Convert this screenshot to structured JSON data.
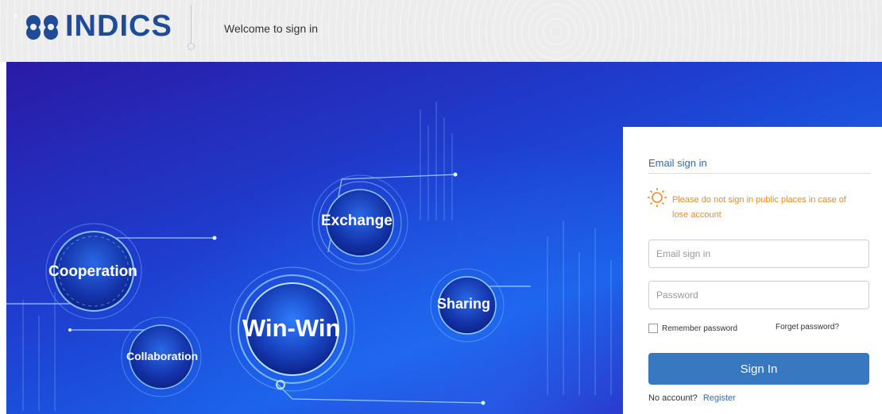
{
  "header": {
    "logo_text": "INDICS",
    "welcome": "Welcome to sign in"
  },
  "banner": {
    "circles": {
      "cooperation": "Cooperation",
      "exchange": "Exchange",
      "sharing": "Sharing",
      "winwin": "Win-Win",
      "collaboration": "Collaboration"
    }
  },
  "login": {
    "tab_title": "Email sign in",
    "warning": "Please do not sign in public places in case of lose account",
    "email_placeholder": "Email sign in",
    "password_placeholder": "Password",
    "remember_label": "Remember password",
    "forget_label": "Forget password?",
    "signin_label": "Sign In",
    "no_account": "No account?",
    "register_label": "Register"
  },
  "colors": {
    "brand": "#1f4b98",
    "link": "#2f6bb5",
    "warning": "#f08a24",
    "button": "#3778c1"
  },
  "icons": {
    "logo": "indics-logo-icon",
    "warning": "bulb-icon"
  }
}
